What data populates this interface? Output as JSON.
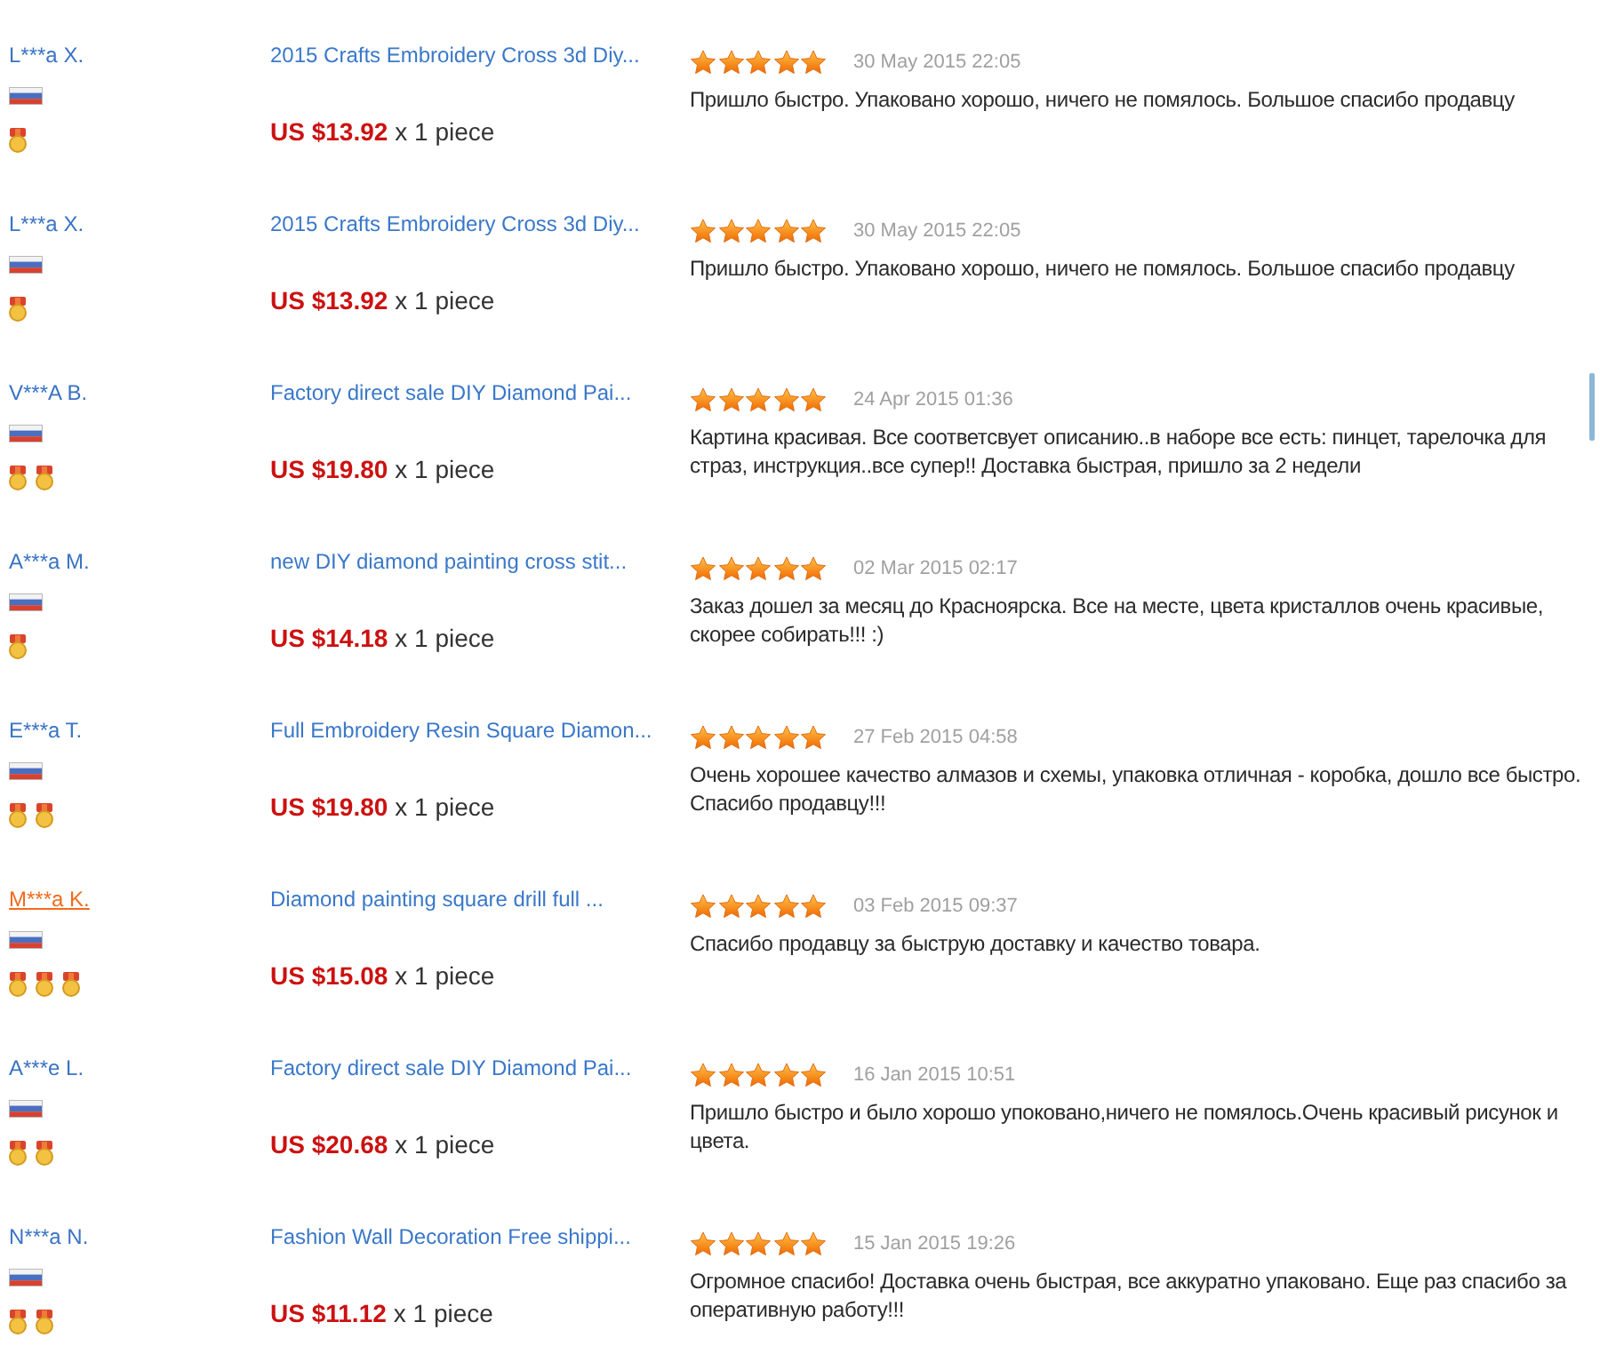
{
  "reviews": [
    {
      "buyer": {
        "name": "L***a X.",
        "hovered": false,
        "medals": [
          {
            "kind": "gold"
          }
        ]
      },
      "product": {
        "title": "2015 Crafts Embroidery Cross 3d Diy...",
        "price": "US $13.92",
        "quantity": "x 1 piece"
      },
      "stars": 5,
      "date": "30 May 2015 22:05",
      "text": "Пришло быстро. Упаковано хорошо, ничего не помялось. Большое спасибо продавцу"
    },
    {
      "buyer": {
        "name": "L***a X.",
        "hovered": false,
        "medals": [
          {
            "kind": "gold"
          }
        ]
      },
      "product": {
        "title": "2015 Crafts Embroidery Cross 3d Diy...",
        "price": "US $13.92",
        "quantity": "x 1 piece"
      },
      "stars": 5,
      "date": "30 May 2015 22:05",
      "text": "Пришло быстро. Упаковано хорошо, ничего не помялось. Большое спасибо продавцу"
    },
    {
      "buyer": {
        "name": "V***A B.",
        "hovered": false,
        "medals": [
          {
            "kind": "gold"
          },
          {
            "kind": "gold"
          }
        ]
      },
      "product": {
        "title": "Factory direct sale DIY Diamond Pai...",
        "price": "US $19.80",
        "quantity": "x 1 piece"
      },
      "stars": 5,
      "date": "24 Apr 2015 01:36",
      "text": "Картина красивая. Все соответсвует описанию..в наборе все есть: пинцет, тарелочка для страз, инструкция..все супер!! Доставка быстрая, пришло за 2 недели"
    },
    {
      "buyer": {
        "name": "A***a M.",
        "hovered": false,
        "medals": [
          {
            "kind": "gold"
          }
        ]
      },
      "product": {
        "title": "new DIY diamond painting cross stit...",
        "price": "US $14.18",
        "quantity": "x 1 piece"
      },
      "stars": 5,
      "date": "02 Mar 2015 02:17",
      "text": "Заказ дошел за месяц до Красноярска. Все на месте, цвета кристаллов очень красивые, скорее собирать!!! :)"
    },
    {
      "buyer": {
        "name": "E***a T.",
        "hovered": false,
        "medals": [
          {
            "kind": "gold"
          },
          {
            "kind": "gold"
          }
        ]
      },
      "product": {
        "title": "Full Embroidery Resin Square Diamon...",
        "price": "US $19.80",
        "quantity": "x 1 piece"
      },
      "stars": 5,
      "date": "27 Feb 2015 04:58",
      "text": "Очень хорошее качество алмазов и схемы, упаковка отличная - коробка, дошло все быстро. Спасибо продавцу!!!"
    },
    {
      "buyer": {
        "name": "M***a K.",
        "hovered": true,
        "medals": [
          {
            "kind": "gold"
          },
          {
            "kind": "gold"
          },
          {
            "kind": "gold"
          }
        ]
      },
      "product": {
        "title": "Diamond painting square drill full ...",
        "price": "US $15.08",
        "quantity": "x 1 piece"
      },
      "stars": 5,
      "date": "03 Feb 2015 09:37",
      "text": "Спасибо продавцу за быструю доставку и качество товара."
    },
    {
      "buyer": {
        "name": "A***e L.",
        "hovered": false,
        "medals": [
          {
            "kind": "gold"
          },
          {
            "kind": "gold"
          }
        ]
      },
      "product": {
        "title": "Factory direct sale DIY Diamond Pai...",
        "price": "US $20.68",
        "quantity": "x 1 piece"
      },
      "stars": 5,
      "date": "16 Jan 2015 10:51",
      "text": "Пришло быстро и было хорошо упоковано,ничего не помялось.Очень красивый рисунок и цвета."
    },
    {
      "buyer": {
        "name": "N***a N.",
        "hovered": false,
        "medals": [
          {
            "kind": "gold"
          },
          {
            "kind": "gold"
          }
        ]
      },
      "product": {
        "title": "Fashion Wall Decoration Free shippi...",
        "price": "US $11.12",
        "quantity": "x 1 piece"
      },
      "stars": 5,
      "date": "15 Jan 2015 19:26",
      "text": "Огромное спасибо! Доставка очень быстрая, все аккуратно упаковано. Еще раз спасибо за оперативную работу!!!"
    }
  ]
}
